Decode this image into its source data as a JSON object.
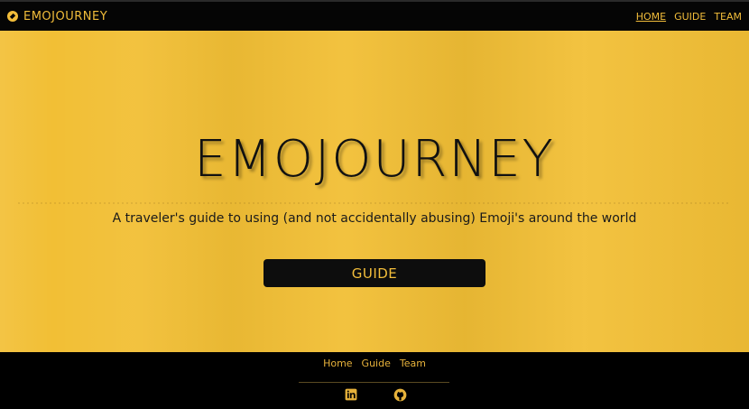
{
  "header": {
    "brand": "EMOJOURNEY",
    "nav": [
      {
        "label": "HOME"
      },
      {
        "label": "GUIDE"
      },
      {
        "label": "TEAM"
      }
    ]
  },
  "hero": {
    "title": "EMOJOURNEY",
    "subtitle": "A traveler's guide to using (and not accidentally abusing) Emoji's around the world",
    "button_label": "GUIDE"
  },
  "footer": {
    "links": [
      {
        "label": "Home"
      },
      {
        "label": "Guide"
      },
      {
        "label": "Team"
      }
    ],
    "social_icons": [
      "linkedin-icon",
      "github-icon"
    ]
  },
  "colors": {
    "brand_gold": "#f2bd3a",
    "hero_background": "#f2bf35",
    "bar_background": "#050505"
  }
}
